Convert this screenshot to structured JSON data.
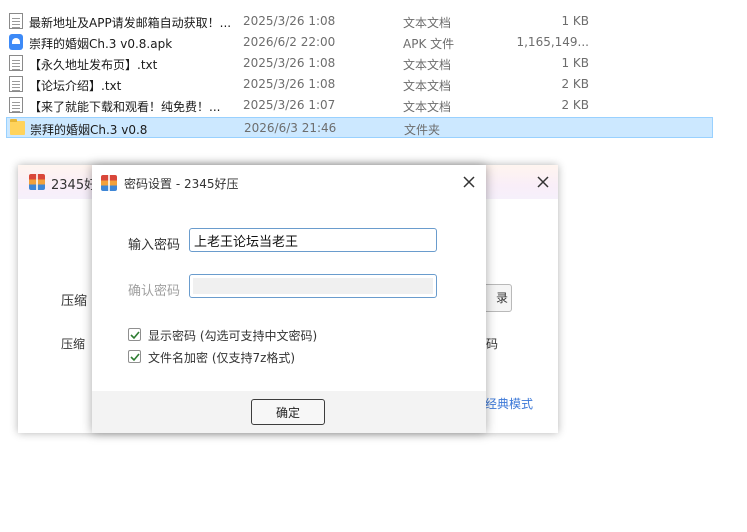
{
  "files": [
    {
      "name": "最新地址及APP请发邮箱自动获取！...",
      "date": "2025/3/26 1:08",
      "type": "文本文档",
      "size": "1 KB",
      "icon": "text-file-icon",
      "selected": false
    },
    {
      "name": "崇拜的婚姻Ch.3 v0.8.apk",
      "date": "2026/6/2 22:00",
      "type": "APK 文件",
      "size": "1,165,149...",
      "icon": "apk-file-icon",
      "selected": false
    },
    {
      "name": "【永久地址发布页】.txt",
      "date": "2025/3/26 1:08",
      "type": "文本文档",
      "size": "1 KB",
      "icon": "text-file-icon",
      "selected": false
    },
    {
      "name": "【论坛介绍】.txt",
      "date": "2025/3/26 1:08",
      "type": "文本文档",
      "size": "2 KB",
      "icon": "text-file-icon",
      "selected": false
    },
    {
      "name": "【来了就能下载和观看！纯免费！...",
      "date": "2025/3/26 1:07",
      "type": "文本文档",
      "size": "2 KB",
      "icon": "text-file-icon",
      "selected": false
    },
    {
      "name": "崇拜的婚姻Ch.3 v0.8",
      "date": "2026/6/3 21:46",
      "type": "文件夹",
      "size": "",
      "icon": "folder-icon",
      "selected": true
    }
  ],
  "main_window": {
    "title": "2345好压",
    "compress_label_1": "压缩",
    "compress_label_2": "压缩",
    "browse_label": "录",
    "right_text": "码",
    "classic_mode": "经典模式"
  },
  "password_dialog": {
    "title": "密码设置 - 2345好压",
    "password_label": "输入密码",
    "password_value": "上老王论坛当老王",
    "confirm_label": "确认密码",
    "show_password": {
      "label": "显示密码 (勾选可支持中文密码)",
      "checked": true
    },
    "encrypt_filenames": {
      "label": "文件名加密 (仅支持7z格式)",
      "checked": true
    },
    "ok_label": "确定"
  },
  "colors": {
    "selection": "#cce8ff",
    "link": "#3c78d8",
    "input_border": "#6a9ccd"
  }
}
